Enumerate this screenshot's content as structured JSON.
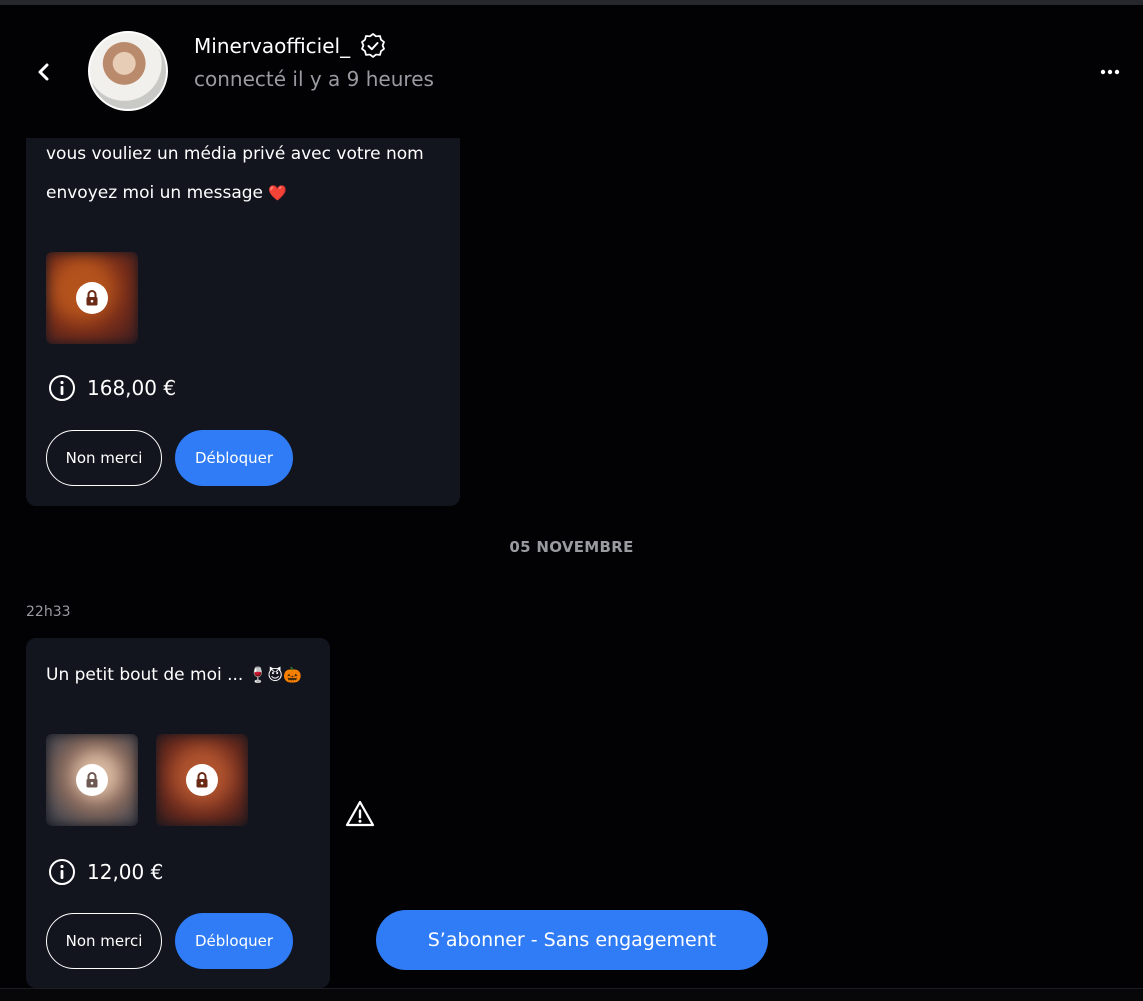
{
  "header": {
    "username": "Minervaofficiel_",
    "status": "connecté il y a 9 heures",
    "back_icon": "chevron-left-icon",
    "verified_icon": "verified-badge-icon",
    "more_icon": "more-horizontal-icon"
  },
  "messages": [
    {
      "text_lines": [
        "vous vouliez un média privé avec votre nom",
        "envoyez moi un message"
      ],
      "emoji": "❤️",
      "price": "168,00 €",
      "decline_label": "Non merci",
      "unlock_label": "Débloquer"
    },
    {
      "time": "22h33",
      "text": "Un petit bout de moi ...",
      "emojis": "🍷😈🎃",
      "price": "12,00 €",
      "decline_label": "Non merci",
      "unlock_label": "Débloquer"
    }
  ],
  "date_separator": "05 NOVEMBRE",
  "subscribe_label": "S’abonner - Sans engagement",
  "colors": {
    "background": "#020205",
    "bubble": "#12151e",
    "accent": "#2f7cf6",
    "muted_text": "#9a9ba1"
  }
}
